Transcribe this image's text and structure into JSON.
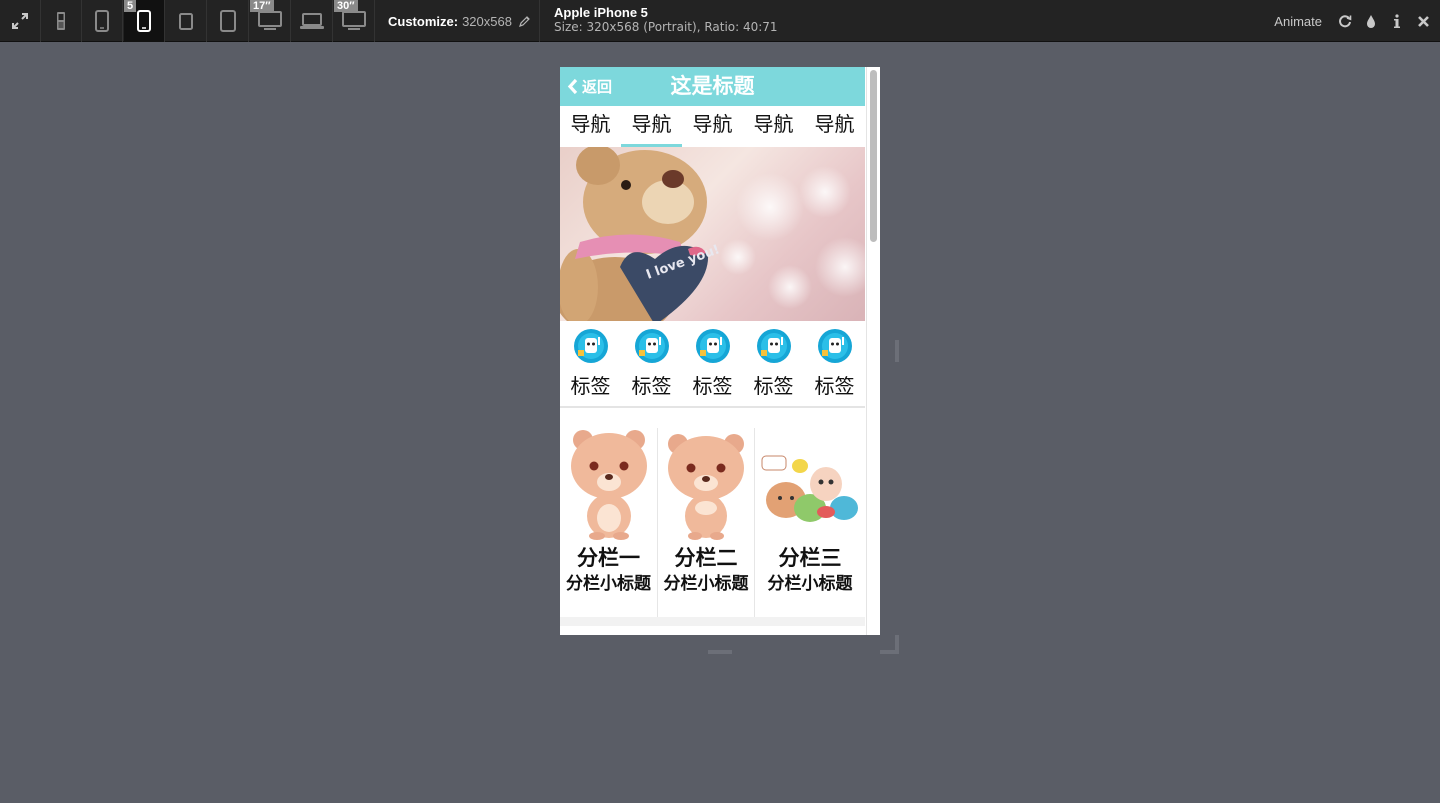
{
  "toolbar": {
    "badges": {
      "iphone5": "5",
      "desktop17": "17″",
      "desktop30": "30″"
    },
    "customize_label": "Customize:",
    "customize_value": "320x568",
    "device_name": "Apple iPhone 5",
    "device_size": "Size: 320x568 (Portrait), Ratio: 40:71",
    "animate_label": "Animate",
    "icons": [
      "expand-icon",
      "phone-old-icon",
      "phone-icon",
      "phone-5-icon",
      "tablet-small-icon",
      "tablet-icon",
      "desktop-17-icon",
      "laptop-icon",
      "desktop-30-icon",
      "pencil-icon",
      "refresh-icon",
      "drop-icon",
      "info-icon",
      "close-icon"
    ]
  },
  "app": {
    "back_label": "返回",
    "title": "这是标题",
    "nav": [
      "导航",
      "导航",
      "导航",
      "导航",
      "导航"
    ],
    "banner_text": "I love you!",
    "tags": [
      "标签",
      "标签",
      "标签",
      "标签",
      "标签"
    ],
    "columns": [
      {
        "title": "分栏一",
        "subtitle": "分栏小标题"
      },
      {
        "title": "分栏二",
        "subtitle": "分栏小标题"
      },
      {
        "title": "分栏三",
        "subtitle": "分栏小标题"
      }
    ],
    "colors": {
      "header": "#7dd8dc",
      "nav_active": "#7dd8dc",
      "toolbar": "#232323",
      "backdrop": "#5a5d66"
    }
  }
}
